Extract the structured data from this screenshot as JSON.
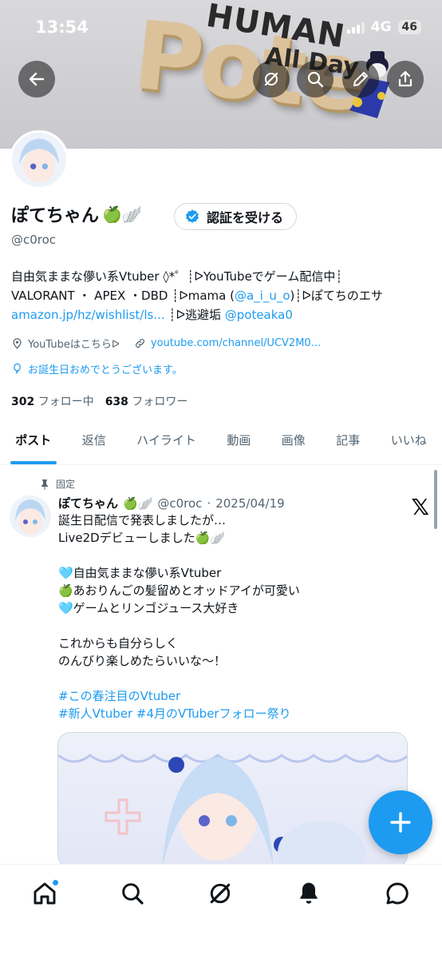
{
  "status_bar": {
    "time": "13:54",
    "network": "4G",
    "battery": "46"
  },
  "banner": {
    "big_text": "Pote",
    "top_text": "HUMAN",
    "sub_text": "All Day"
  },
  "profile": {
    "display_name": "ぽてちゃん",
    "name_emoji": "🍏🪽",
    "verify_button": "認証を受ける",
    "handle": "@c0roc",
    "bio": {
      "line1": "自由気ままな儚い系Vtuber ◊*゜┊ᐅYouTubeでゲーム配信中┊",
      "line2_a": "VALORANT ・ APEX ・DBD ┊ᐅmama (",
      "line2_link": "@a_i_u_o",
      "line2_b": ")┊ᐅぽてちのエサ",
      "line3_link": "amazon.jp/hz/wishlist/ls...",
      "line3_a": " ┊ᐅ逃避垢 ",
      "line3_link2": "@poteaka0"
    },
    "location": "YouTubeはこちらᐅ",
    "website": "youtube.com/channel/UCV2M0...",
    "birthday": "お誕生日おめでとうございます。",
    "following_count": "302",
    "following_label": "フォロー中",
    "followers_count": "638",
    "followers_label": "フォロワー"
  },
  "tabs": [
    "ポスト",
    "返信",
    "ハイライト",
    "動画",
    "画像",
    "記事",
    "いいね"
  ],
  "active_tab": 0,
  "post": {
    "pinned_label": "固定",
    "author": "ぽてちゃん",
    "author_emoji": "🍏🪽",
    "handle": "@c0roc",
    "date": "2025/04/19",
    "lines": [
      "誕生日配信で発表しましたが…",
      "Live2Dデビューしました🍏🪽",
      "",
      "🩵自由気ままな儚い系Vtuber",
      "🍏あおりんごの髪留めとオッドアイが可愛い",
      "🩵ゲームとリンゴジュース大好き",
      "",
      "これからも自分らしく",
      "のんびり楽しめたらいいな〜！",
      ""
    ],
    "hashtag_line1": "#この春注目のVtuber",
    "hashtag_line2": "#新人Vtuber  #4月のVTuberフォロー祭り"
  },
  "bottom_nav": [
    "home-icon",
    "search-icon",
    "grok-icon",
    "notifications-icon",
    "messages-icon"
  ],
  "colors": {
    "accent": "#1d9bf0",
    "text": "#0f1419",
    "muted": "#536471"
  }
}
